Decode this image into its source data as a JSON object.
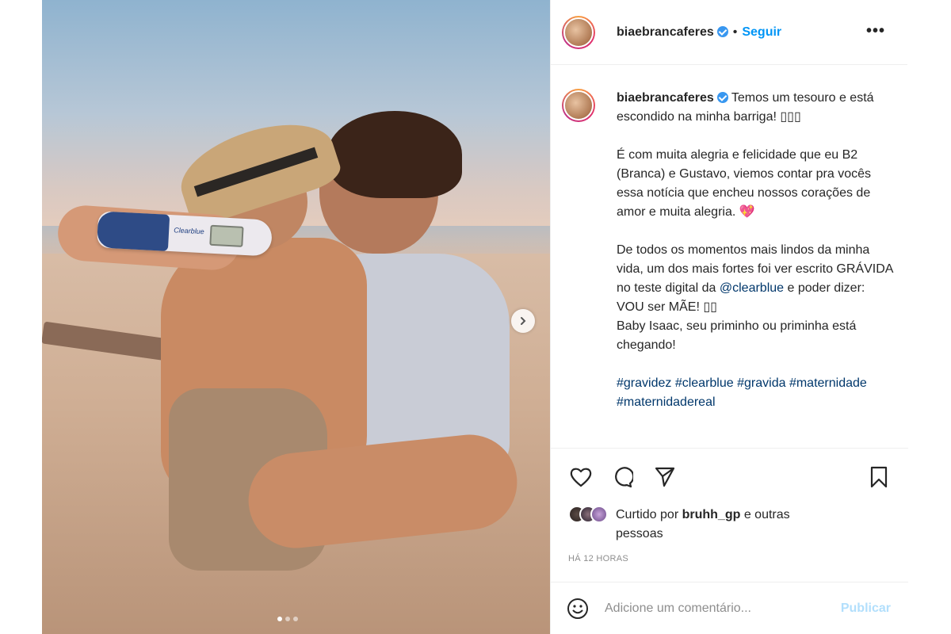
{
  "post": {
    "username": "biaebrancaferes",
    "follow_label": "Seguir",
    "separator": "•",
    "more_label": "•••",
    "caption": {
      "line1": "Temos um tesouro e está escondido na minha barriga! ▯▯▯",
      "para2": "É com muita alegria e felicidade que eu B2 (Branca) e Gustavo, viemos contar pra vocês essa notícia que encheu nossos corações de amor e muita alegria. 💖",
      "para3_a": "De todos os momentos mais lindos da minha vida, um dos mais fortes foi ver escrito GRÁVIDA no teste digital da",
      "mention": "@clearblue",
      "para3_b": "e poder dizer: VOU ser MÃE! ▯▯",
      "para3_c": "Baby Isaac, seu priminho ou priminha está chegando!",
      "hashtags": [
        "#gravidez",
        "#clearblue",
        "#gravida",
        "#maternidade",
        "#maternidadereal"
      ]
    },
    "liked_prefix": "Curtido por",
    "liked_user": "bruhh_gp",
    "liked_suffix": "e outras pessoas",
    "timestamp": "HÁ 12 HORAS",
    "comment_placeholder": "Adicione um comentário...",
    "publish_label": "Publicar",
    "test_brand": "Clearblue",
    "carousel": {
      "total": 3,
      "current": 1
    }
  },
  "icons": [
    "heart-icon",
    "comment-icon",
    "share-icon",
    "bookmark-icon",
    "emoji-icon",
    "chevron-right-icon",
    "verified-icon"
  ],
  "colors": {
    "accent": "#0095f6",
    "link": "#00376b",
    "muted": "#8e8e8e",
    "publish_disabled": "#b2dffc"
  }
}
